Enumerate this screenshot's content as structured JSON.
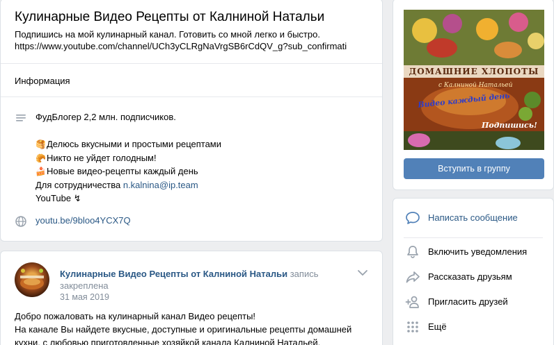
{
  "group": {
    "title": "Кулинарные Видео Рецепты от Калниной Натальи",
    "status_line1": "Подпишись на мой кулинарный канал. Готовить со мной легко и быстро.",
    "status_line2": "https://www.youtube.com/channel/UCh3yCLRgNaVrgSB6rCdQV_g?sub_confirmati"
  },
  "info": {
    "header": "Информация",
    "description": {
      "line1": "ФудБлогер 2,2 млн. подписчиков.",
      "line2_emoji": "🥞",
      "line2": "Делюсь вкусными и простыми рецептами",
      "line3_emoji": "🥐",
      "line3": "Никто не уйдет голодным!",
      "line4_emoji": "🍰",
      "line4": "Новые видео-рецепты каждый день",
      "line5_prefix": "Для сотрудничества",
      "line5_link": "n.kalnina@ip.team",
      "line6": "YouTube ↯"
    },
    "website": "youtu.be/9bloo4YCX7Q"
  },
  "post": {
    "author": "Кулинарные Видео Рецепты от Калниной Натальи",
    "note": "запись закреплена",
    "date": "31 мая 2019",
    "text_line1": "Добро пожаловать на кулинарный канал Видео рецепты!",
    "text_line2": "На канале Вы найдете вкусные, доступные и оригинальные рецепты домашней",
    "text_line3": "кухни, с любовью приготовленные хозяйкой канала Калниной Натальей."
  },
  "cover": {
    "text1": "ДОМАШНИЕ ХЛОПОТЫ",
    "text2": "с Калниной Натальей",
    "text3": "Видео каждый день",
    "text4": "Подпишись!"
  },
  "join_button": "Вступить в группу",
  "actions": {
    "message": "Написать сообщение",
    "notifications": "Включить уведомления",
    "share": "Рассказать друзьям",
    "invite": "Пригласить друзей",
    "more": "Ещё"
  },
  "colors": {
    "link": "#2a5885",
    "button": "#5181b8",
    "icon": "#99a2ad",
    "icon_accent": "#5181b8"
  }
}
